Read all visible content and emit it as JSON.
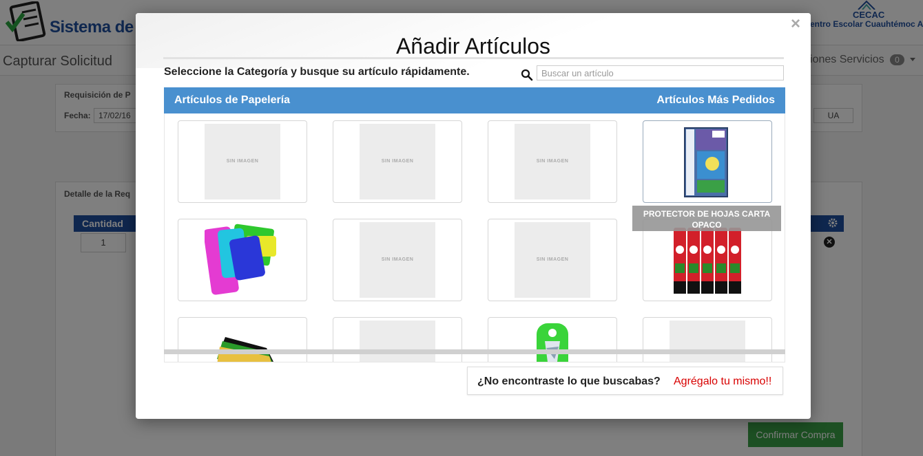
{
  "app": {
    "title": "Sistema de Re",
    "org_acronym": "CECAC",
    "org_name": "entro Escolar Cuauhtémoc A.C.",
    "page_heading": "Capturar Solicitud",
    "nav_right_label": "iones Servicios",
    "nav_badge": "0"
  },
  "requisition": {
    "title": "Requisición de P",
    "date_label": "Fecha:",
    "date_value": "17/02/16",
    "ua_label": "UA"
  },
  "detail": {
    "title": "Detalle de la Req",
    "qty_header": "Cantidad",
    "qty_value": "1",
    "remove_glyph": "✕",
    "confirm_label": "Confirmar Compra"
  },
  "modal": {
    "close_glyph": "×",
    "title": "Añadir Artículos",
    "instructions": "Seleccione la Categoría y busque su artículo rápidamente.",
    "search_placeholder": "Buscar un artículo",
    "category_left": "Artículos de Papelería",
    "category_right": "Artículos Más Pedidos",
    "no_image_text": "SIN IMAGEN",
    "tooltip_text": "PROTECTOR DE HOJAS CARTA OPACO",
    "not_found_question": "¿No encontraste lo que buscabas?",
    "not_found_link": "Agrégalo tu mismo!!"
  },
  "products": [
    {
      "image": "no-image"
    },
    {
      "image": "no-image"
    },
    {
      "image": "no-image"
    },
    {
      "image": "sheet-protectors-icon"
    },
    {
      "image": "crepe-paper-icon"
    },
    {
      "image": "no-image"
    },
    {
      "image": "no-image"
    },
    {
      "image": "glue-sticks-icon"
    },
    {
      "image": "color-sheets-icon"
    },
    {
      "image": "no-image"
    },
    {
      "image": "scissors-package-icon"
    },
    {
      "image": "no-image"
    }
  ],
  "colors": {
    "category_bar": "#4990cf",
    "link_red": "#d80000",
    "confirm_green": "#3aa046",
    "brand_blue": "#1f4e9e"
  }
}
